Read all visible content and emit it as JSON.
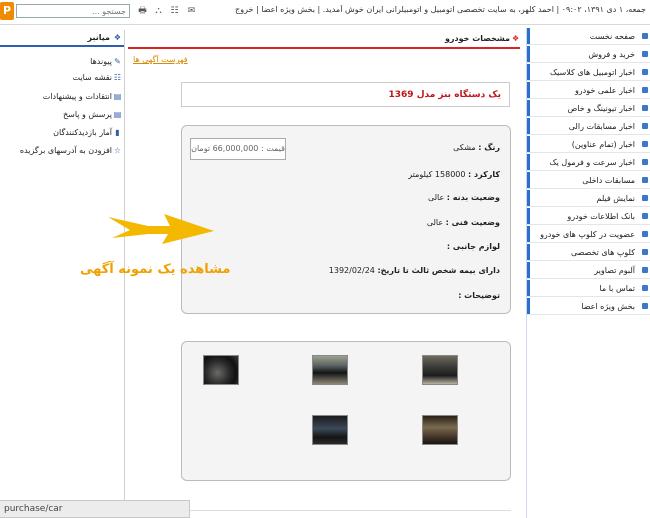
{
  "topbar": {
    "logo_letter": "P",
    "search_placeholder": "جستجو ...",
    "welcome_line1": "جمعه، ۱ دی ۱۳۹۱، ۰۹:۰۲ | احمد کلهر، به سایت تخصصی اتومبیل و اتومبیلرانی ایران خوش آمدید. | بخش ویژه اعضا | خروج",
    "welcome_line2": ""
  },
  "right_menu": {
    "items": [
      "صفحه نخست",
      "خرید و فروش",
      "اخبار اتومبیل های کلاسیک",
      "اخبار علمی خودرو",
      "اخبار تیونینگ و خاص",
      "اخبار مسابقات رالی",
      "اخبار (تمام عناوین)",
      "اخبار سرعت و فرمول یک",
      "مسابقات داخلی",
      "نمایش فیلم",
      "بانک اطلاعات خودرو",
      "عضویت در کلوپ های خودرو",
      "کلوپ های تخصصی",
      "آلبوم تصاویر",
      "تماس با ما",
      "بخش ویژه اعضا"
    ]
  },
  "left_sidebar": {
    "header": "میانبر",
    "items": [
      "پیوندها",
      "نقشه سایت",
      "انتقادات و پیشنهادات",
      "پرسش و پاسخ",
      "آمار بازدیدکنندگان",
      "افزودن به آدرسهای برگزیده"
    ]
  },
  "main": {
    "header": "مشخصات خودرو",
    "list_link": "فهرست آگهی ها",
    "ad_title": "یک دستگاه بنز مدل 1369",
    "price_label": "قیمت : 66,000,000 تومان",
    "fields": [
      {
        "label": "رنگ :",
        "value": " مشکی"
      },
      {
        "label": "کارکرد :",
        "value": " 158000 کیلومتر"
      },
      {
        "label": "وضعیت بدنه :",
        "value": " عالی"
      },
      {
        "label": "وضعیت فنی :",
        "value": " عالی"
      },
      {
        "label": "لوازم جانبی :",
        "value": ""
      },
      {
        "label": "دارای بیمه شخص ثالث تا تاریخ:",
        "value": " 1392/02/24"
      },
      {
        "label": "توضیحات :",
        "value": ""
      }
    ]
  },
  "annotation": {
    "caption": "مشاهده یک نمونه آگهی"
  },
  "statusbar": {
    "url": "purchase/car"
  },
  "colors": {
    "accent_red": "#d22222",
    "menu_blue": "#2a6fd0",
    "annotation_orange": "#f0a000"
  }
}
